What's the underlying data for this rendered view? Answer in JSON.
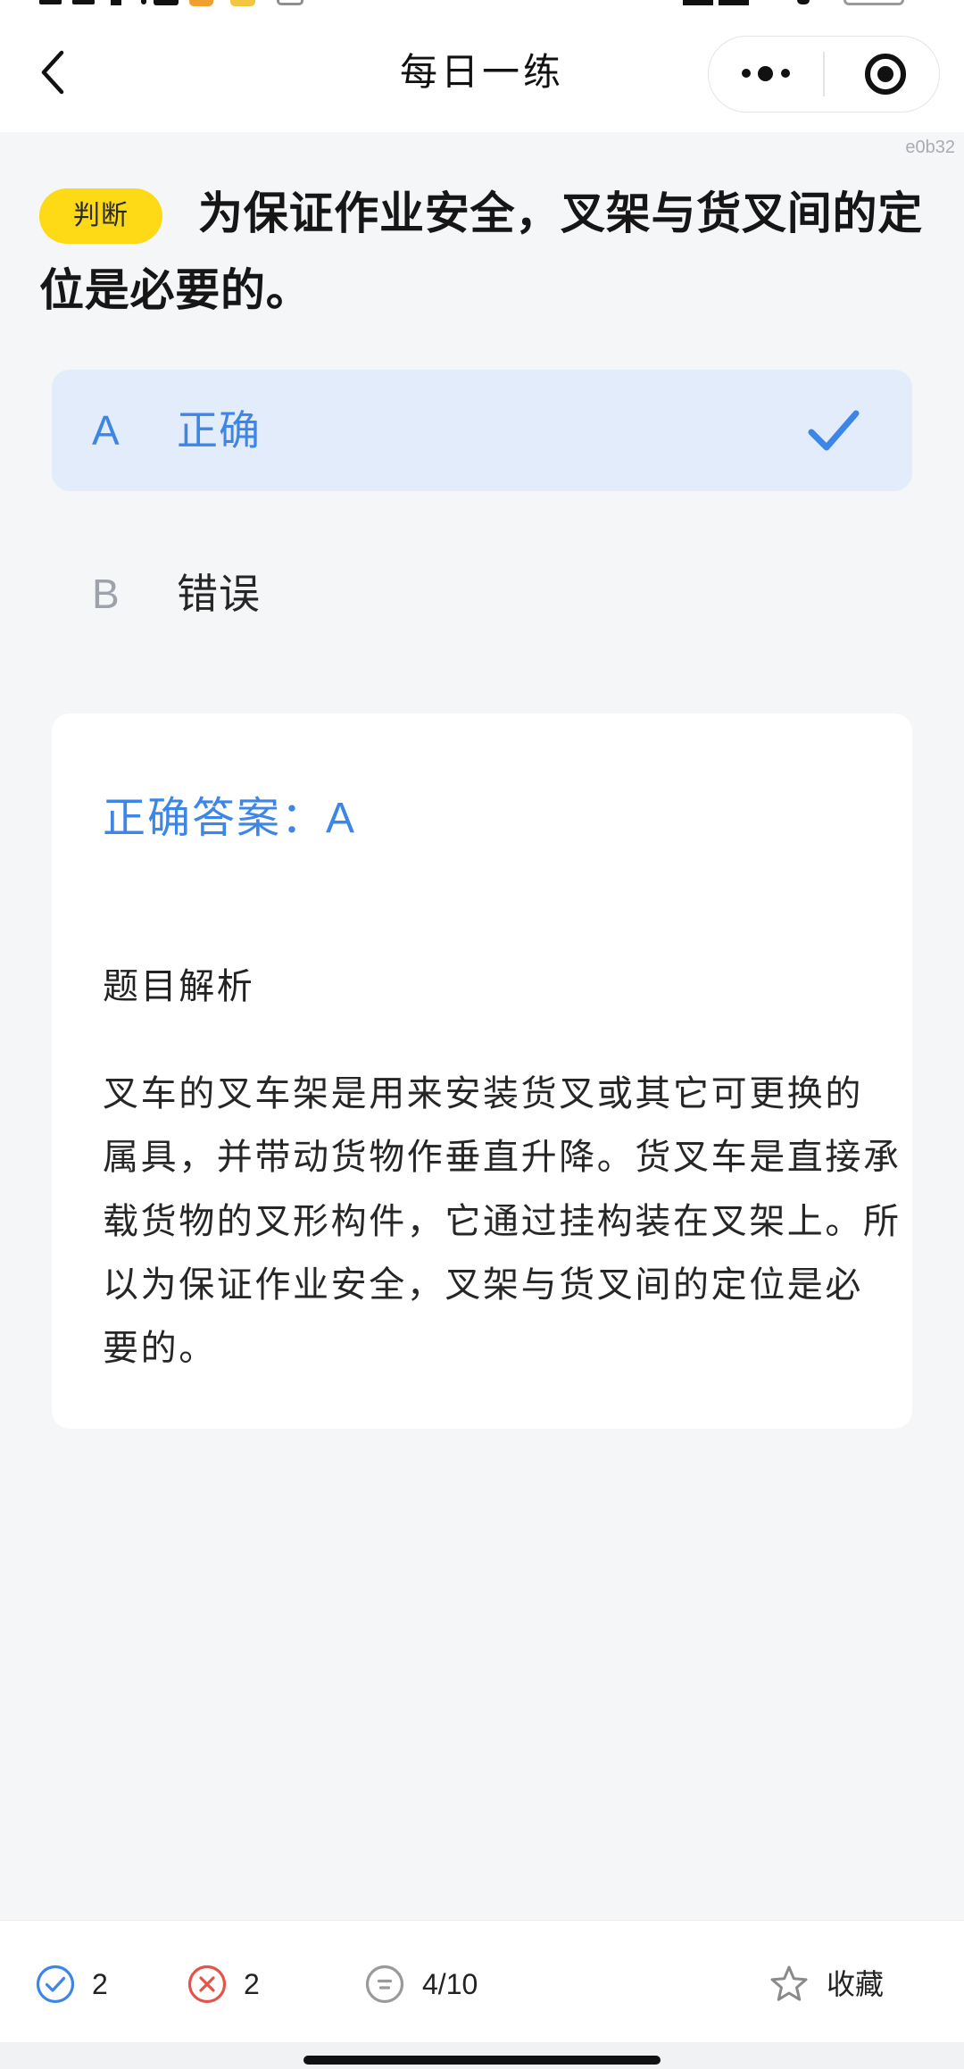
{
  "header": {
    "title": "每日一练",
    "icons": {
      "back": "chevron-left-icon",
      "more": "more-dots-icon",
      "exit": "target-circle-icon"
    }
  },
  "corner_tag": "e0b32",
  "question": {
    "type_badge": "判断",
    "text": "为保证作业安全，叉架与货叉间的定位是必要的。",
    "options": [
      {
        "letter": "A",
        "text": "正确",
        "selected": true,
        "mark_icon": "checkmark-icon"
      },
      {
        "letter": "B",
        "text": "错误",
        "selected": false
      }
    ]
  },
  "answer_card": {
    "correct_answer_label": "正确答案：",
    "correct_answer": "A",
    "analysis_title": "题目解析",
    "analysis_lines": [
      "叉车的叉车架是用来安装货叉或其它可更换的",
      "属具，并带动货物作垂直升降。货叉车是直接承",
      "载货物的叉形构件，它通过挂构装在叉架上。所",
      "以为保证作业安全，叉架与货叉间的定位是必",
      "要的。"
    ]
  },
  "bottom_bar": {
    "correct_count": "2",
    "wrong_count": "2",
    "progress": "4/10",
    "favorite_label": "收藏",
    "icons": {
      "correct": "check-circle-icon",
      "wrong": "x-circle-icon",
      "progress": "list-circle-icon",
      "favorite": "star-outline-icon"
    }
  },
  "colors": {
    "accent": "#3d85e6",
    "badge": "#fdd916",
    "selected_option_bg": "#e3ecfa",
    "wrong": "#e5534b",
    "page_bg": "#f5f6f8"
  }
}
